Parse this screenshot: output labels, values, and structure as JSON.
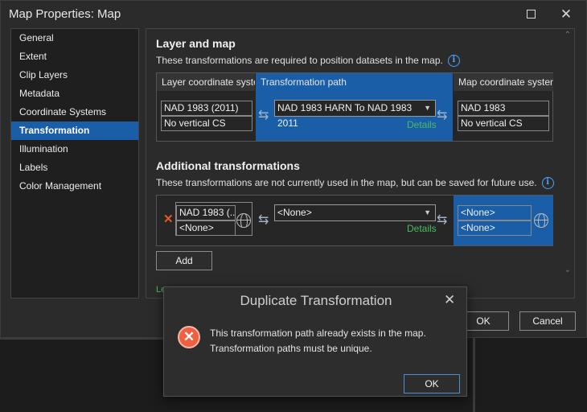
{
  "window": {
    "title": "Map Properties: Map",
    "maximize_icon": "maximize-icon",
    "close_icon": "close-icon",
    "close_glyph": "✕"
  },
  "sidebar": {
    "items": [
      {
        "label": "General",
        "active": false
      },
      {
        "label": "Extent",
        "active": false
      },
      {
        "label": "Clip Layers",
        "active": false
      },
      {
        "label": "Metadata",
        "active": false
      },
      {
        "label": "Coordinate Systems",
        "active": false
      },
      {
        "label": "Transformation",
        "active": true
      },
      {
        "label": "Illumination",
        "active": false
      },
      {
        "label": "Labels",
        "active": false
      },
      {
        "label": "Color Management",
        "active": false
      }
    ]
  },
  "layer_map": {
    "title": "Layer and map",
    "description": "These transformations are required to position datasets in the map.",
    "columns": [
      "Layer coordinate system",
      "Transformation path",
      "Map coordinate system"
    ],
    "layer_cs": {
      "horizontal": "NAD 1983 (2011)",
      "vertical": "No vertical CS"
    },
    "transformation_path": "NAD 1983 HARN To NAD 1983 2011",
    "details_link": "Details",
    "map_cs": {
      "horizontal": "NAD 1983",
      "vertical": "No vertical CS"
    }
  },
  "additional": {
    "title": "Additional transformations",
    "description": "These transformations are not currently used in the map, but can be saved for future use.",
    "layer_cs": {
      "horizontal": "NAD 1983 (...",
      "vertical": "<None>"
    },
    "transformation_path": "<None>",
    "details_link": "Details",
    "map_cs": {
      "horizontal": "<None>",
      "vertical": "<None>"
    },
    "add_button": "Add",
    "partial_link": "Le"
  },
  "footer": {
    "ok": "OK",
    "cancel": "Cancel"
  },
  "dialog": {
    "title": "Duplicate Transformation",
    "close_glyph": "✕",
    "message_line1": "This transformation path already exists in the map.",
    "message_line2": "Transformation paths must be unique.",
    "ok": "OK",
    "icon": "error-icon"
  },
  "colors": {
    "accent": "#1a5ea8",
    "link_green": "#4cbb5e",
    "error": "#f06040"
  }
}
